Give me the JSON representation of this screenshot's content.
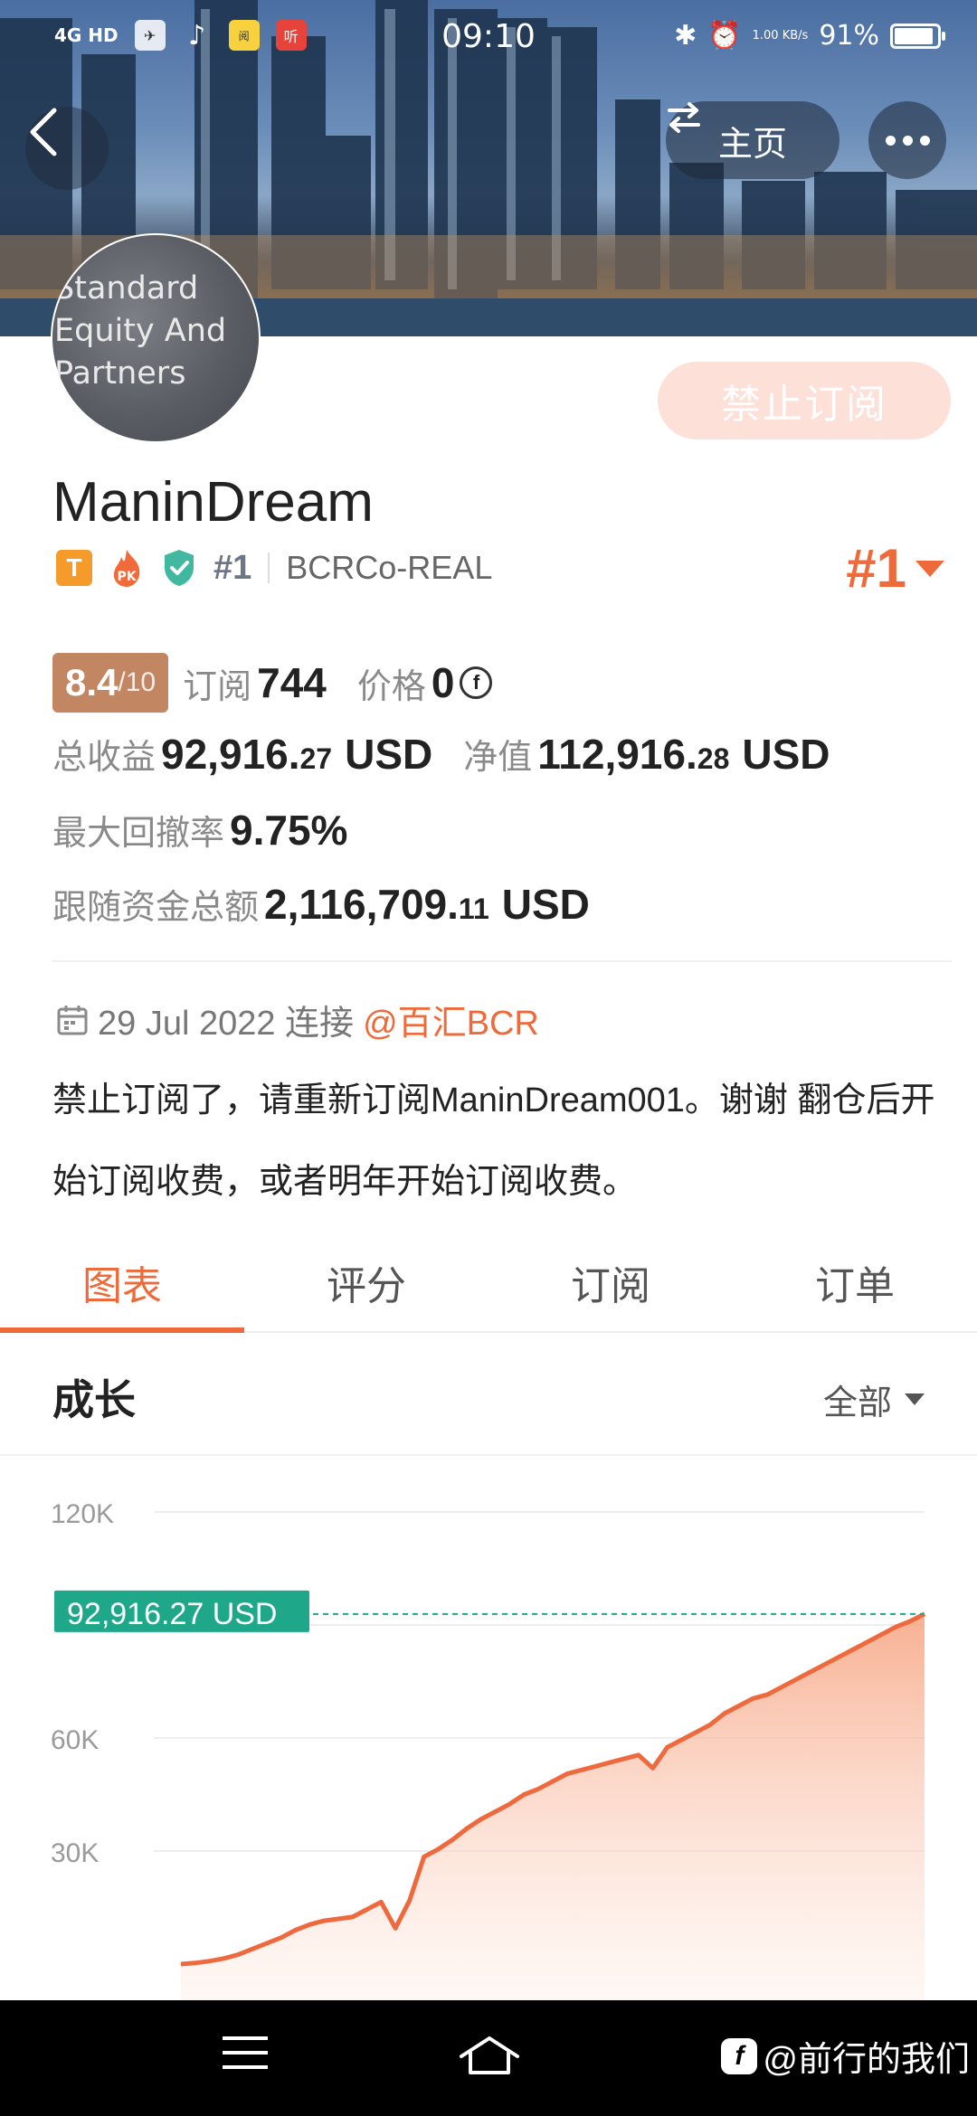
{
  "status_bar": {
    "network": "4G HD",
    "apps": [
      "携程",
      "抖音",
      "阅",
      "听"
    ],
    "time": "09:10",
    "speed": "1.00 KB/s",
    "battery": "91%",
    "battery_level": 0.91
  },
  "header": {
    "home_label": "主页",
    "avatar_text": "Standard Equity And Partners",
    "subscribe_button": "禁止订阅"
  },
  "profile": {
    "name": "ManinDream",
    "badge_t": "T",
    "badge_pk": "PK",
    "rank_small": "#1",
    "account": "BCRCo-REAL",
    "rank_big": "#1"
  },
  "stats": {
    "score": "8.4",
    "score_max": "/10",
    "subscribe_label": "订阅",
    "subscribe_count": "744",
    "price_label": "价格",
    "price_value": "0",
    "price_coin": "f",
    "total_profit_label": "总收益",
    "total_profit_int": "92,916.",
    "total_profit_dec": "27",
    "total_profit_unit": "USD",
    "net_label": "净值",
    "net_int": "112,916.",
    "net_dec": "28",
    "net_unit": "USD",
    "drawdown_label": "最大回撤率",
    "drawdown_value": "9.75%",
    "follow_label": "跟随资金总额",
    "follow_int": "2,116,709.",
    "follow_dec": "11",
    "follow_unit": "USD"
  },
  "post": {
    "date": "29 Jul 2022 连接",
    "mention": "@百汇BCR",
    "text": "禁止订阅了，请重新订阅ManinDream001。谢谢 翻仓后开始订阅收费，或者明年开始订阅收费。"
  },
  "tabs": [
    "图表",
    "评分",
    "订阅",
    "订单"
  ],
  "section": {
    "title": "成长",
    "filter": "全部"
  },
  "chart_data": {
    "type": "area",
    "title": "成长",
    "y_ticks": [
      "120K",
      "60K",
      "30K"
    ],
    "ylim": [
      0,
      120000
    ],
    "current_label": "92,916.27 USD",
    "current_value": 92916.27,
    "values": [
      0,
      300,
      800,
      1500,
      2500,
      4000,
      5500,
      7000,
      9000,
      10500,
      11500,
      12000,
      12500,
      14500,
      16500,
      9500,
      17000,
      28500,
      30500,
      33000,
      36000,
      38500,
      40500,
      42500,
      45000,
      46500,
      48500,
      50500,
      51500,
      52500,
      53500,
      54500,
      55500,
      52000,
      57500,
      59500,
      61500,
      63500,
      66500,
      68500,
      70500,
      71500,
      73500,
      75500,
      77500,
      79500,
      81500,
      83500,
      85500,
      87500,
      89500,
      91000,
      92916.27
    ],
    "colors": {
      "line": "#ee6a3e",
      "fill": "#f8b89c",
      "marker": "#1fa78a"
    }
  },
  "navbar": {
    "watermark": "@前行的我们",
    "watermark_logo": "f"
  }
}
